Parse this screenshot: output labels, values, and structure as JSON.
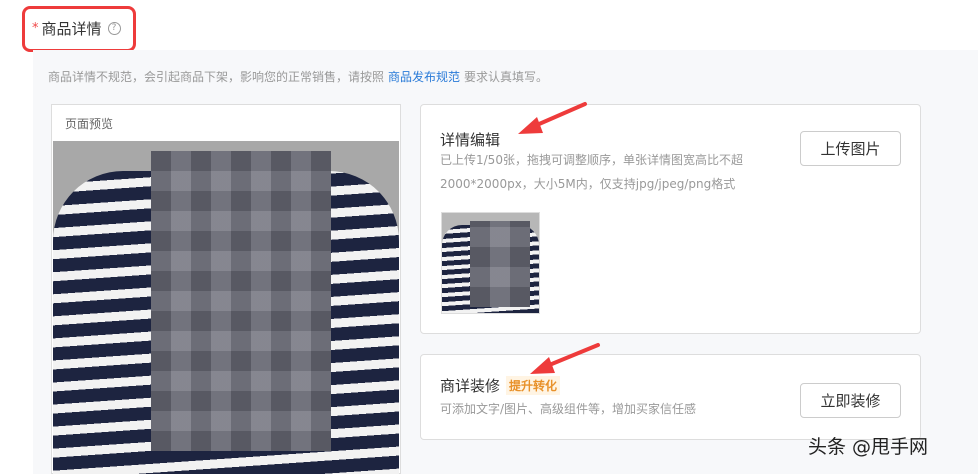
{
  "header": {
    "required_mark": "*",
    "title": "商品详情",
    "help_icon": "question-circle-icon"
  },
  "notice": {
    "text_before": "商品详情不规范，会引起商品下架，影响您的正常销售，请按照",
    "link": "商品发布规范",
    "text_after": "要求认真填写。"
  },
  "preview": {
    "label": "页面预览"
  },
  "detail_edit": {
    "title": "详情编辑",
    "desc_line1": "已上传1/50张，拖拽可调整顺序，单张详情图宽高比不超",
    "desc_line2": "2000*2000px，大小5M内，仅支持jpg/jpeg/png格式",
    "upload_button": "上传图片"
  },
  "decoration": {
    "title": "商详装修",
    "badge": "提升转化",
    "desc": "可添加文字/图片、高级组件等，增加买家信任感",
    "button": "立即装修"
  },
  "watermark": "头条 @甩手网",
  "colors": {
    "highlight_border": "#ee3b3b",
    "link": "#2a7bd8",
    "badge_text": "#e8912a",
    "badge_bg": "#fff4e3",
    "arrow": "#ee3b3b"
  }
}
